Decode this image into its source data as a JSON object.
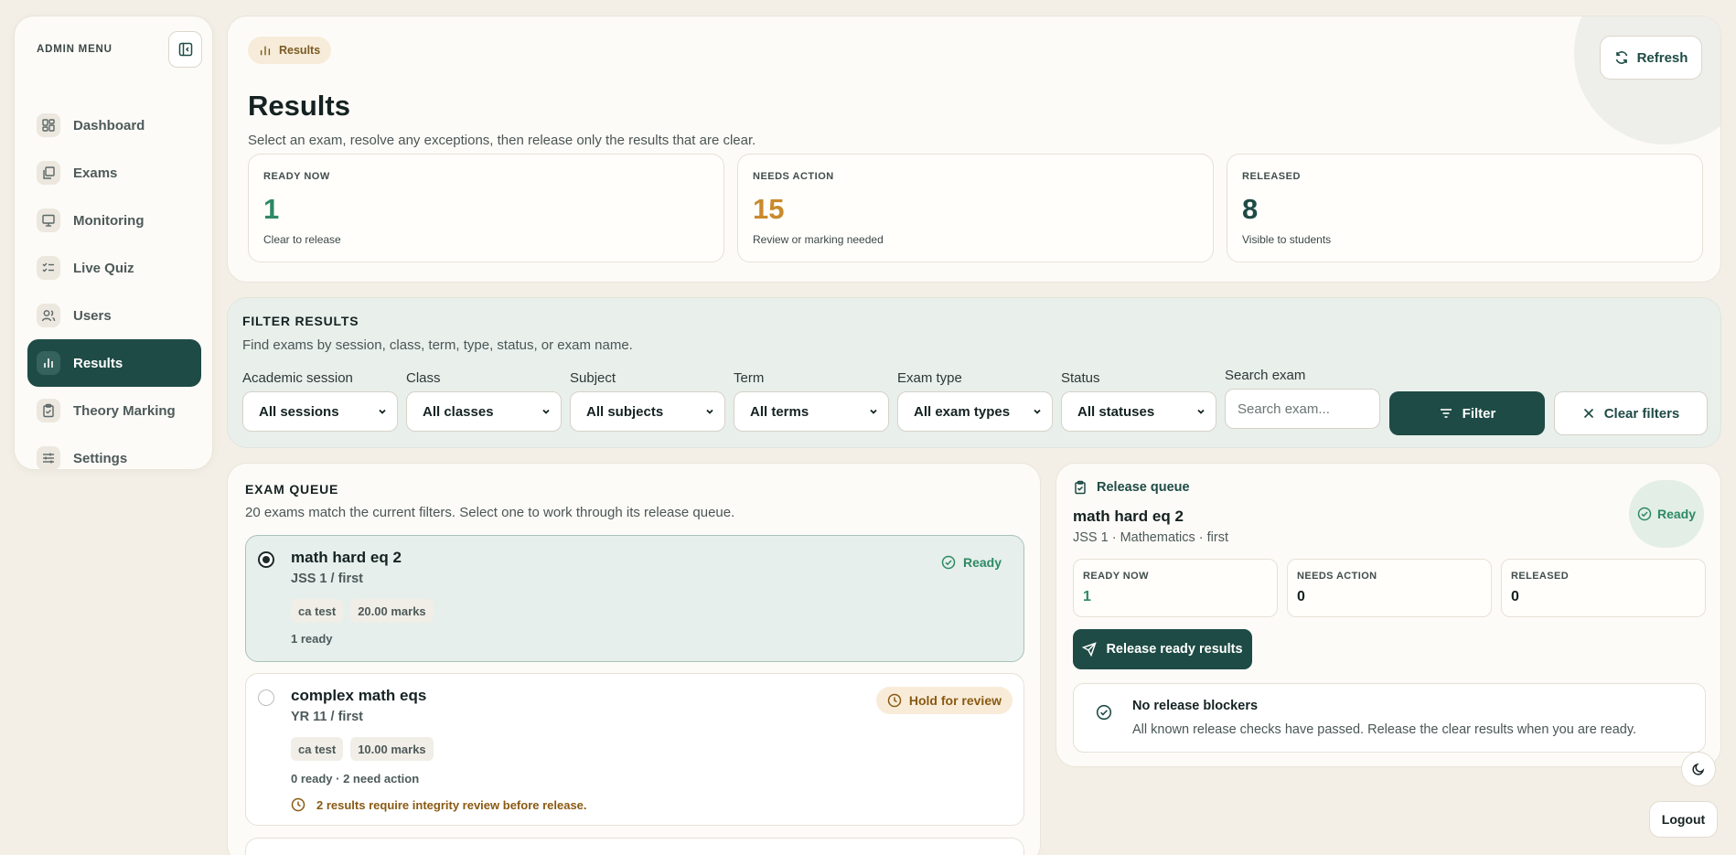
{
  "sidebar": {
    "heading": "ADMIN MENU",
    "items": [
      {
        "label": "Dashboard",
        "icon": "dashboard-icon"
      },
      {
        "label": "Exams",
        "icon": "exams-icon"
      },
      {
        "label": "Monitoring",
        "icon": "monitor-icon"
      },
      {
        "label": "Live Quiz",
        "icon": "checklist-icon"
      },
      {
        "label": "Users",
        "icon": "users-icon"
      },
      {
        "label": "Results",
        "icon": "bar-chart-icon",
        "active": true
      },
      {
        "label": "Theory Marking",
        "icon": "clipboard-icon"
      },
      {
        "label": "Settings",
        "icon": "sliders-icon"
      }
    ]
  },
  "header": {
    "pill": "Results",
    "title": "Results",
    "subtitle": "Select an exam, resolve any exceptions, then release only the results that are clear.",
    "refresh": "Refresh",
    "stats": [
      {
        "label": "READY NOW",
        "value": "1",
        "caption": "Clear to release",
        "color": "#2d8a63"
      },
      {
        "label": "NEEDS ACTION",
        "value": "15",
        "caption": "Review or marking needed",
        "color": "#c98a2c"
      },
      {
        "label": "RELEASED",
        "value": "8",
        "caption": "Visible to students",
        "color": "#1e4b45"
      }
    ]
  },
  "filters": {
    "title": "FILTER RESULTS",
    "subtitle": "Find exams by session, class, term, type, status, or exam name.",
    "fields": [
      {
        "label": "Academic session",
        "value": "All sessions"
      },
      {
        "label": "Class",
        "value": "All classes"
      },
      {
        "label": "Subject",
        "value": "All subjects"
      },
      {
        "label": "Term",
        "value": "All terms"
      },
      {
        "label": "Exam type",
        "value": "All exam types"
      },
      {
        "label": "Status",
        "value": "All statuses"
      }
    ],
    "search_label": "Search exam",
    "search_placeholder": "Search exam...",
    "filter_btn": "Filter",
    "clear_btn": "Clear filters"
  },
  "queue": {
    "title": "EXAM QUEUE",
    "subtitle": "20 exams match the current filters. Select one to work through its release queue.",
    "exams": [
      {
        "name": "math hard eq 2",
        "cls": "JSS 1 / first",
        "tags": [
          "ca test",
          "20.00 marks"
        ],
        "meta": "1 ready",
        "badge": "Ready"
      },
      {
        "name": "complex math eqs",
        "cls": "YR 11 / first",
        "tags": [
          "ca test",
          "10.00 marks"
        ],
        "meta": "0 ready · 2 need action",
        "badge": "Hold for review",
        "warning": "2 results require integrity review before release."
      }
    ]
  },
  "release": {
    "head": "Release queue",
    "name": "math hard eq 2",
    "meta": "JSS 1 · Mathematics · first",
    "status": "Ready",
    "stats": [
      {
        "label": "READY NOW",
        "value": "1",
        "color": "#2d8a63"
      },
      {
        "label": "NEEDS ACTION",
        "value": "0",
        "color": "#152222"
      },
      {
        "label": "RELEASED",
        "value": "0",
        "color": "#152222"
      }
    ],
    "button": "Release ready results",
    "blocker_title": "No release blockers",
    "blocker_desc": "All known release checks have passed. Release the clear results when you are ready."
  },
  "logout": "Logout"
}
